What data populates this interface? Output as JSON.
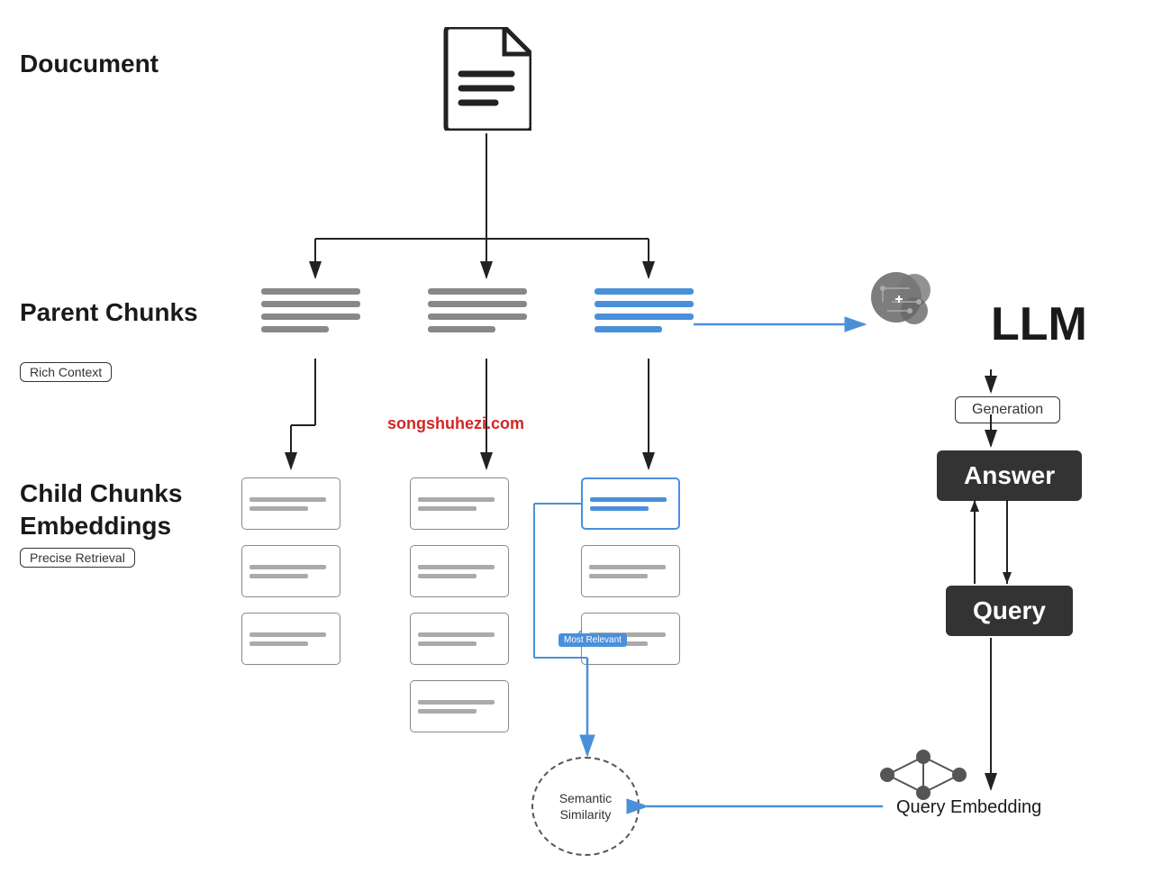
{
  "labels": {
    "document": "Doucument",
    "parent_chunks": "Parent Chunks",
    "rich_context": "Rich Context",
    "child_chunks": "Child Chunks\nEmbeddings",
    "child_line1": "Child Chunks",
    "child_line2": "Embeddings",
    "precise_retrieval": "Precise Retrieval",
    "llm": "LLM",
    "generation": "Generation",
    "answer": "Answer",
    "query": "Query",
    "query_embedding": "Query Embedding",
    "semantic_similarity_line1": "Semantic",
    "semantic_similarity_line2": "Similarity",
    "most_relevant": "Most Relevant",
    "watermark": "songshuhezi.com"
  },
  "colors": {
    "blue": "#4a90d9",
    "dark": "#333333",
    "gray": "#888888",
    "light_gray": "#aaaaaa"
  }
}
